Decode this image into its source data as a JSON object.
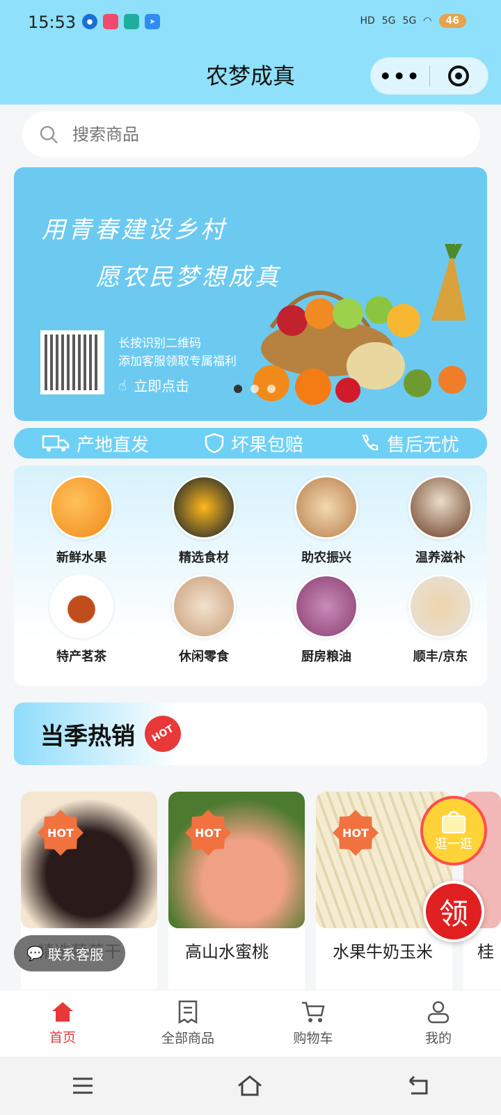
{
  "status_bar": {
    "time": "15:53",
    "battery": "46",
    "network_1": "5G",
    "network_2": "5G",
    "hd": "HD"
  },
  "header": {
    "title": "农梦成真",
    "more_label": "•••"
  },
  "search": {
    "placeholder": "搜索商品"
  },
  "banner": {
    "line1": "用青春建设乡村",
    "line2": "愿农民梦想成真",
    "tip1": "长按识别二维码",
    "tip2": "添加客服领取专属福利",
    "click_label": "立即点击"
  },
  "features": [
    {
      "label": "产地直发",
      "icon": "truck-icon"
    },
    {
      "label": "坏果包赔",
      "icon": "shield-icon"
    },
    {
      "label": "售后无忧",
      "icon": "phone-icon"
    }
  ],
  "categories": [
    {
      "label": "新鲜水果",
      "color": "#f7a43a"
    },
    {
      "label": "精选食材",
      "color": "#f0a420"
    },
    {
      "label": "助农振兴",
      "color": "#d9b27a"
    },
    {
      "label": "温养滋补",
      "color": "#8a5a3c"
    },
    {
      "label": "特产茗茶",
      "color": "#c9632a"
    },
    {
      "label": "休闲零食",
      "color": "#e8d2b4"
    },
    {
      "label": "厨房粮油",
      "color": "#b05a8c"
    },
    {
      "label": "顺丰/京东",
      "color": "#d8c6a8"
    }
  ],
  "hot_section": {
    "title": "当季热销",
    "badge": "HOT"
  },
  "products": [
    {
      "name": "精选葡萄干",
      "tag": "HOT",
      "color": "#3a2a2a"
    },
    {
      "name": "高山水蜜桃",
      "tag": "HOT",
      "color": "#e8917a"
    },
    {
      "name": "水果牛奶玉米",
      "tag": "HOT",
      "color": "#efe6c8"
    },
    {
      "name": "桂",
      "tag": "",
      "color": "#f2b7b7"
    }
  ],
  "floating": {
    "shop_label": "逛一逛",
    "ling_label": "领",
    "service_label": "联系客服"
  },
  "tabbar": [
    {
      "label": "首页",
      "active": true
    },
    {
      "label": "全部商品",
      "active": false
    },
    {
      "label": "购物车",
      "active": false
    },
    {
      "label": "我的",
      "active": false
    }
  ]
}
